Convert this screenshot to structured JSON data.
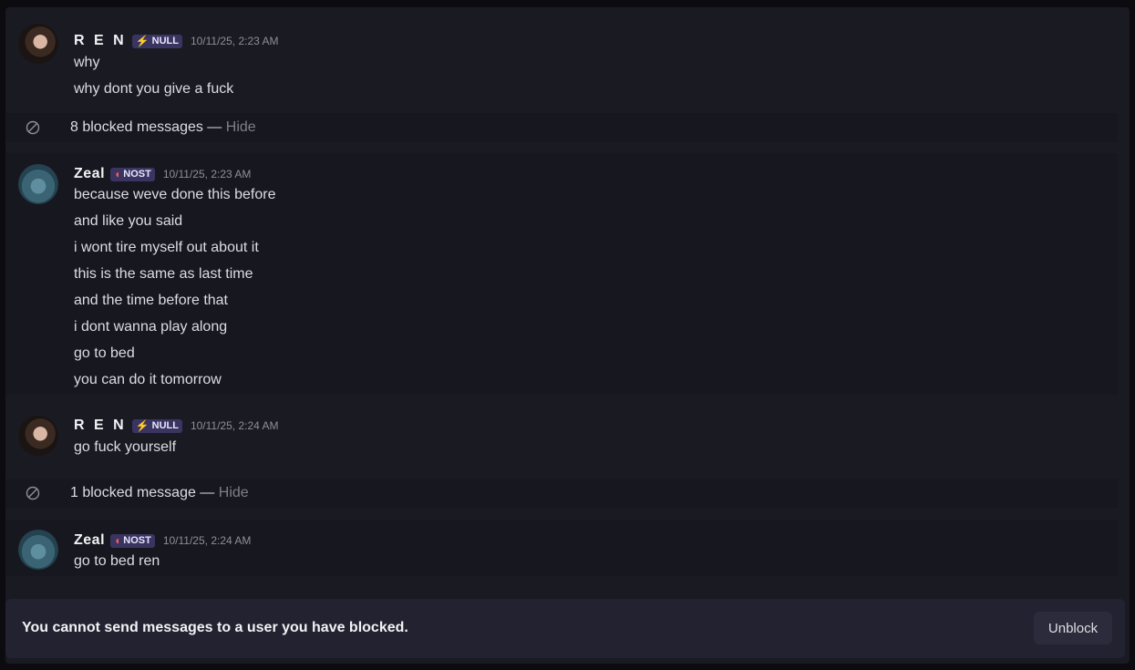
{
  "messages": [
    {
      "author": "R E N",
      "tag": {
        "icon": "⚡",
        "label": "NULL"
      },
      "timestamp": "10/11/25, 2:23 AM",
      "lines": [
        "why",
        "why dont you give a fuck"
      ]
    },
    {
      "author": "Zeal",
      "tag": {
        "icon": "◖",
        "label": "NOST"
      },
      "timestamp": "10/11/25, 2:23 AM",
      "lines": [
        "because weve done this before",
        "and like you said",
        "i wont tire myself out about it",
        "this is the same as last time",
        "and the time before that",
        "i dont wanna play along",
        "go to bed",
        "you can do it tomorrow"
      ]
    },
    {
      "author": "R E N",
      "tag": {
        "icon": "⚡",
        "label": "NULL"
      },
      "timestamp": "10/11/25, 2:24 AM",
      "lines": [
        "go fuck yourself"
      ]
    },
    {
      "author": "Zeal",
      "tag": {
        "icon": "◖",
        "label": "NOST"
      },
      "timestamp": "10/11/25, 2:24 AM",
      "lines": [
        "go to bed ren"
      ]
    }
  ],
  "blocked": [
    {
      "text": "8 blocked messages —",
      "hide": "Hide"
    },
    {
      "text": "1 blocked message —",
      "hide": "Hide"
    }
  ],
  "footer": {
    "notice": "You cannot send messages to a user you have blocked.",
    "unblock_label": "Unblock"
  },
  "colors": {
    "background": "#1a1a23",
    "tag_bg": "#3a3560",
    "null_icon": "#f2c12e",
    "nost_icon": "#ff5a5a"
  }
}
